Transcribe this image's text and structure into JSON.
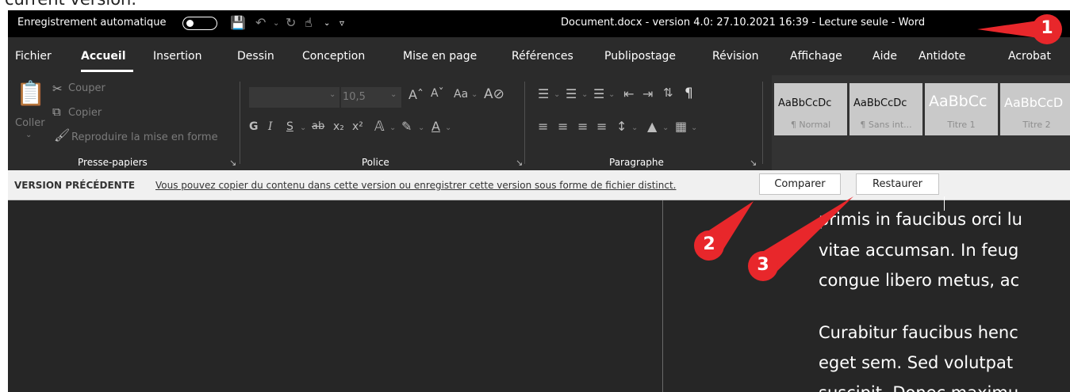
{
  "caption_fragment": "current version.",
  "titlebar": {
    "autosave_label": "Enregistrement automatique",
    "title": "Document.docx  -  version 4.0: 27.10.2021 16:39  -  Lecture seule  -  Word"
  },
  "menu": {
    "items": [
      "Fichier",
      "Accueil",
      "Insertion",
      "Dessin",
      "Conception",
      "Mise en page",
      "Références",
      "Publipostage",
      "Révision",
      "Affichage",
      "Aide",
      "Antidote",
      "Acrobat"
    ],
    "active": "Accueil"
  },
  "ribbon": {
    "clipboard": {
      "paste": "Coller",
      "cut": "Couper",
      "copy": "Copier",
      "format_painter": "Reproduire la mise en forme",
      "group_label": "Presse-papiers"
    },
    "font": {
      "size": "10,5",
      "bold": "G",
      "italic": "I",
      "underline": "S",
      "case": "Aa",
      "group_label": "Police"
    },
    "paragraph": {
      "group_label": "Paragraphe"
    },
    "styles": [
      {
        "sample": "AaBbCcDc",
        "name": "¶ Normal"
      },
      {
        "sample": "AaBbCcDc",
        "name": "¶ Sans int..."
      },
      {
        "sample": "AaBbCc",
        "name": "Titre 1"
      },
      {
        "sample": "AaBbCcD",
        "name": "Titre 2"
      }
    ]
  },
  "version_bar": {
    "label": "VERSION PRÉCÉDENTE",
    "message": "Vous pouvez copier du contenu dans cette version ou enregistrer cette version sous forme de fichier distinct.",
    "compare_button": "Comparer",
    "restore_button": "Restaurer"
  },
  "document": {
    "lines": [
      "primis in faucibus orci lu",
      "vitae accumsan. In feug",
      "congue libero metus, ac",
      "Curabitur faucibus henc",
      "eget sem. Sed volutpat",
      "suscipit. Donec maximu"
    ]
  },
  "callouts": {
    "one": "1",
    "two": "2",
    "three": "3",
    "color": "#e8272b"
  }
}
